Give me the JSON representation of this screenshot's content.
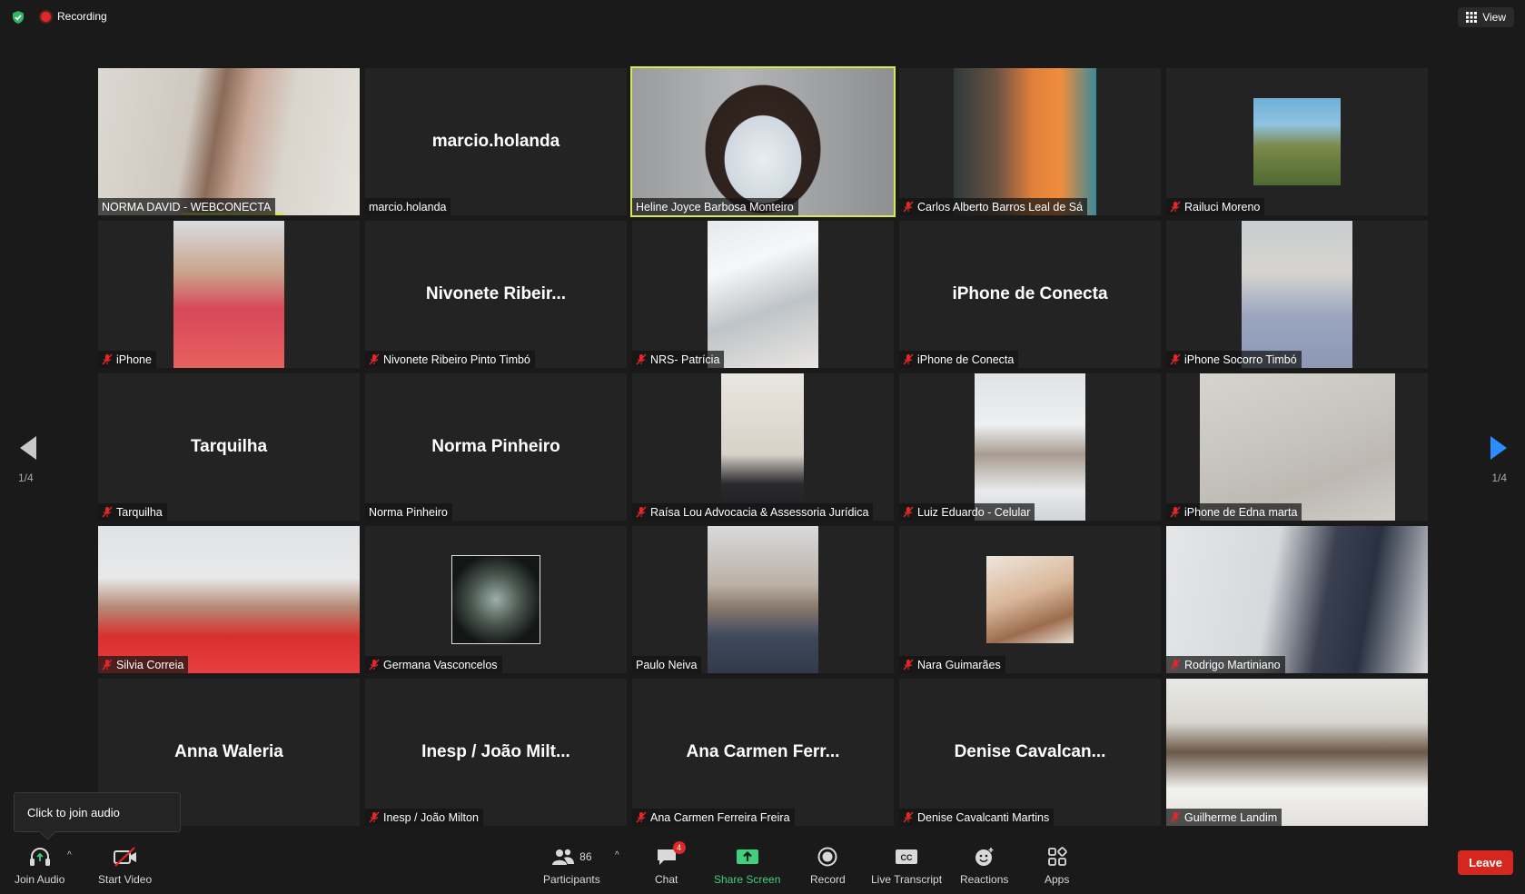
{
  "topbar": {
    "recording_label": "Recording",
    "view_label": "View"
  },
  "pagination": {
    "left": "1/4",
    "right": "1/4"
  },
  "tiles": [
    {
      "label": "NORMA DAVID - WEBCONECTA",
      "muted": false
    },
    {
      "display_name": "marcio.holanda",
      "label": "marcio.holanda",
      "muted": false
    },
    {
      "label": "Heline Joyce Barbosa Monteiro",
      "muted": false,
      "active": true
    },
    {
      "label": "Carlos Alberto Barros Leal de Sá",
      "muted": true
    },
    {
      "label": "Railuci Moreno",
      "muted": true
    },
    {
      "label": "iPhone",
      "muted": true
    },
    {
      "display_name": "Nivonete  Ribeir...",
      "label": "Nivonete Ribeiro Pinto Timbó",
      "muted": true
    },
    {
      "label": "NRS- Patrícia",
      "muted": true
    },
    {
      "display_name": "iPhone de Conecta",
      "label": "iPhone de Conecta",
      "muted": true
    },
    {
      "label": "iPhone Socorro Timbó",
      "muted": true
    },
    {
      "display_name": "Tarquilha",
      "label": "Tarquilha",
      "muted": true
    },
    {
      "display_name": "Norma Pinheiro",
      "label": "Norma Pinheiro",
      "muted": false
    },
    {
      "label": "Raísa Lou Advocacia & Assessoria Jurídica",
      "muted": true
    },
    {
      "label": "Luiz Eduardo - Celular",
      "muted": true
    },
    {
      "label": "iPhone de Edna marta",
      "muted": true
    },
    {
      "label": "Silvia Correia",
      "muted": true
    },
    {
      "label": "Germana Vasconcelos",
      "muted": true
    },
    {
      "label": "Paulo Neiva",
      "muted": false
    },
    {
      "label": "Nara Guimarães",
      "muted": true
    },
    {
      "label": "Rodrigo Martiniano",
      "muted": true
    },
    {
      "display_name": "Anna Waleria",
      "muted": false
    },
    {
      "display_name": "Inesp / João Milt...",
      "label": "Inesp / João Milton",
      "muted": true
    },
    {
      "display_name": "Ana Carmen Ferr...",
      "label": "Ana Carmen Ferreira Freira",
      "muted": true
    },
    {
      "display_name": "Denise  Cavalcan...",
      "label": "Denise Cavalcanti Martins",
      "muted": true
    },
    {
      "label": "Guilherme Landim",
      "muted": true
    }
  ],
  "tooltip": {
    "text": "Click to join audio"
  },
  "toolbar": {
    "join_audio": "Join Audio",
    "start_video": "Start Video",
    "participants": "Participants",
    "participants_count": "86",
    "chat": "Chat",
    "chat_badge": "4",
    "share_screen": "Share Screen",
    "record": "Record",
    "live_transcript": "Live Transcript",
    "reactions": "Reactions",
    "apps": "Apps",
    "leave": "Leave"
  },
  "colors": {
    "background": "#1a1a1a",
    "tile": "#232323",
    "active_speaker": "#d8e84e",
    "muted_icon": "#e02828",
    "share_green": "#3ed07c",
    "leave_red": "#d4281f"
  }
}
